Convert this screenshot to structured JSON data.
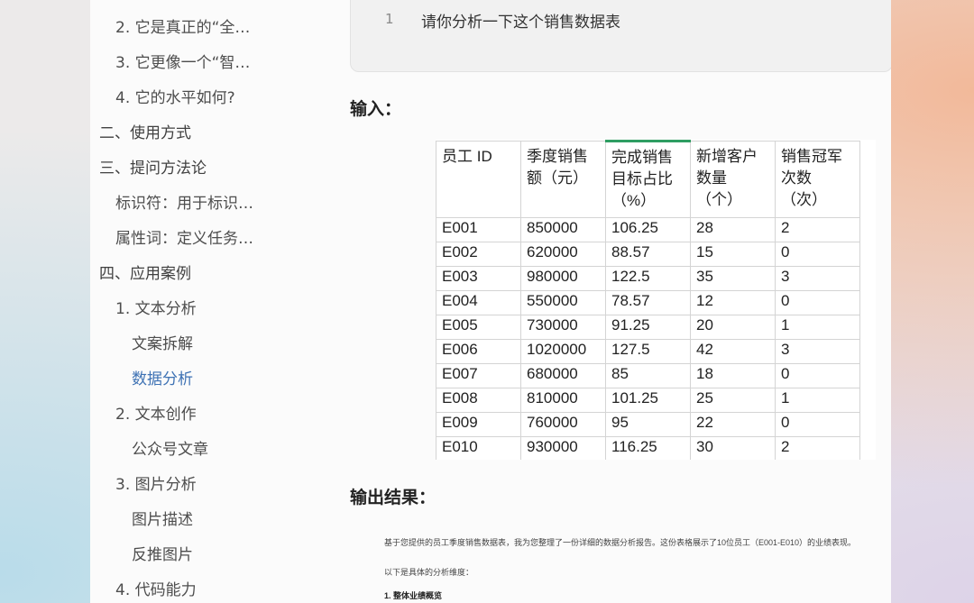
{
  "sidebar": {
    "items": [
      {
        "label": "2. 它是真正的“全…",
        "level": 2
      },
      {
        "label": "3. 它更像一个“智…",
        "level": 2
      },
      {
        "label": "4. 它的水平如何?",
        "level": 2
      },
      {
        "label": "二、使用方式",
        "level": 1
      },
      {
        "label": "三、提问方法论",
        "level": 1
      },
      {
        "label": "标识符：用于标识…",
        "level": 2
      },
      {
        "label": "属性词：定义任务…",
        "level": 2
      },
      {
        "label": "四、应用案例",
        "level": 1
      },
      {
        "label": "1. 文本分析",
        "level": 2
      },
      {
        "label": "文案拆解",
        "level": 3
      },
      {
        "label": "数据分析",
        "level": 3,
        "active": true
      },
      {
        "label": "2. 文本创作",
        "level": 2
      },
      {
        "label": "公众号文章",
        "level": 3
      },
      {
        "label": "3. 图片分析",
        "level": 2
      },
      {
        "label": "图片描述",
        "level": 3
      },
      {
        "label": "反推图片",
        "level": 3
      },
      {
        "label": "4. 代码能力",
        "level": 2
      }
    ],
    "active_color": "#3e72b4"
  },
  "code_block": {
    "line_number": "1",
    "text": "请你分析一下这个销售数据表"
  },
  "input_heading": "输入：",
  "table": {
    "headers": [
      [
        "员工 ID"
      ],
      [
        "季度销售",
        "额（元）"
      ],
      [
        "完成销售",
        "目标占比",
        "（%）"
      ],
      [
        "新增客户",
        "数量",
        "（个）"
      ],
      [
        "销售冠军",
        "次数",
        "（次）"
      ]
    ],
    "rows": [
      [
        "E001",
        "850000",
        "106.25",
        "28",
        "2"
      ],
      [
        "E002",
        "620000",
        "88.57",
        "15",
        "0"
      ],
      [
        "E003",
        "980000",
        "122.5",
        "35",
        "3"
      ],
      [
        "E004",
        "550000",
        "78.57",
        "12",
        "0"
      ],
      [
        "E005",
        "730000",
        "91.25",
        "20",
        "1"
      ],
      [
        "E006",
        "1020000",
        "127.5",
        "42",
        "3"
      ],
      [
        "E007",
        "680000",
        "85",
        "18",
        "0"
      ],
      [
        "E008",
        "810000",
        "101.25",
        "25",
        "1"
      ],
      [
        "E009",
        "760000",
        "95",
        "22",
        "0"
      ],
      [
        "E010",
        "930000",
        "116.25",
        "30",
        "2"
      ]
    ],
    "selected_header_color": "#2e9d62"
  },
  "output_heading": "输出结果：",
  "output": {
    "intro": "基于您提供的员工季度销售数据表，我为您整理了一份详细的数据分析报告。这份表格展示了10位员工（E001-E010）的业绩表现。",
    "lead": "以下是具体的分析维度：",
    "section1": "1. 整体业绩概览"
  }
}
